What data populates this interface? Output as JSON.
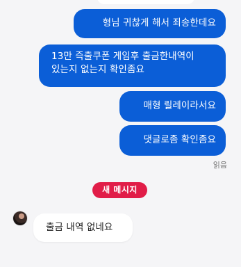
{
  "conversation": {
    "messages": [
      {
        "direction": "sent",
        "text": "형님 귀찮게 해서 죄송한데요"
      },
      {
        "direction": "sent",
        "text": "13만 즉출쿠폰 게임후 출금한내역이\n있는지 없는지 확인좀요"
      },
      {
        "direction": "sent",
        "text": "매형 릴레이라서요"
      },
      {
        "direction": "sent",
        "text": "댓글로좀 확인좀요"
      }
    ],
    "read_status": "읽음",
    "new_messages_label": "새 메시지",
    "incoming": [
      {
        "direction": "received",
        "text": "출금 내역 없네요"
      }
    ]
  },
  "colors": {
    "sent_bubble": "#0b5ed7",
    "received_bubble": "#ffffff",
    "background": "#f5f5f7",
    "new_badge": "#e11d48"
  }
}
